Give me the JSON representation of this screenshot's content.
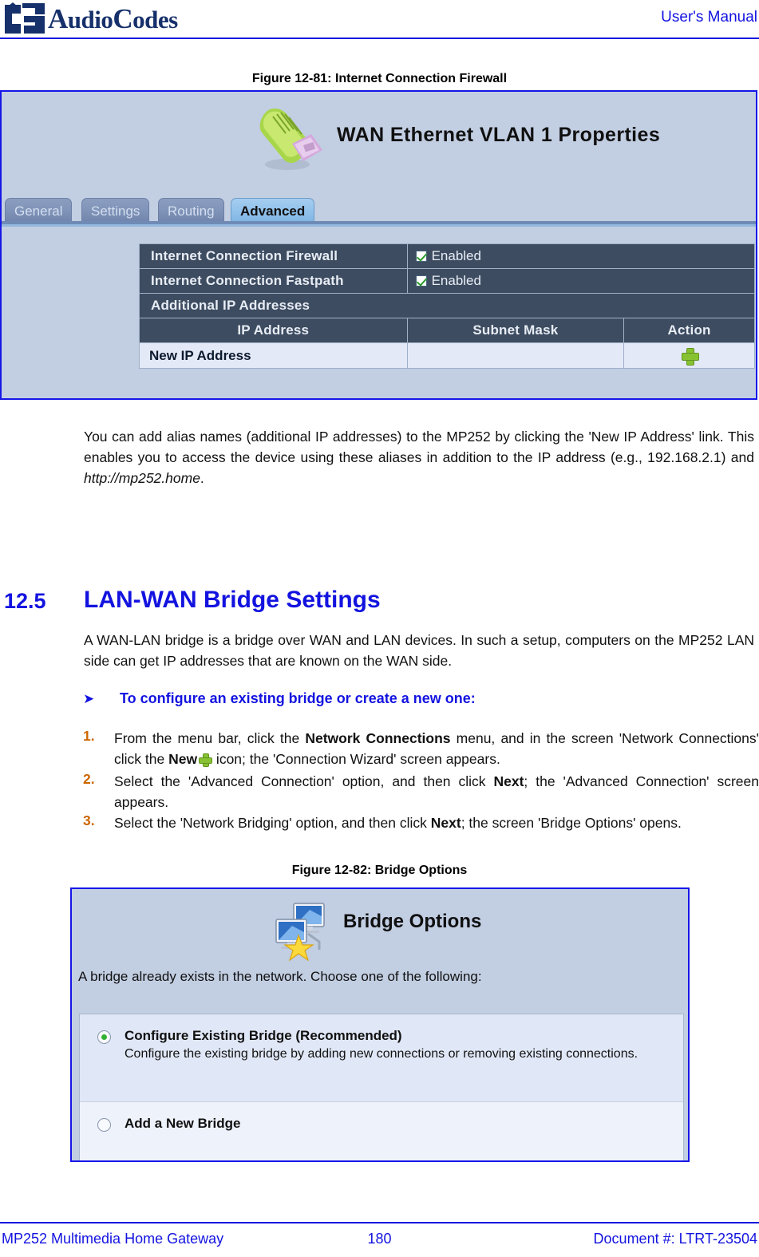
{
  "header": {
    "brand": "AudioCodes",
    "brand_prefix": "Audio",
    "brand_suffix": "Codes",
    "manual_label": "User's Manual",
    "logo_icon": "audiocodes-logo-icon",
    "brand_color": "#16306b",
    "accent_color": "#1313e0"
  },
  "figure1": {
    "caption": "Figure 12-81: Internet Connection Firewall",
    "title": "WAN Ethernet VLAN 1 Properties",
    "title_icon": "ethernet-plug-icon",
    "tabs": [
      {
        "label": "General",
        "active": false
      },
      {
        "label": "Settings",
        "active": false
      },
      {
        "label": "Routing",
        "active": false
      },
      {
        "label": "Advanced",
        "active": true
      }
    ],
    "settings": [
      {
        "label": "Internet Connection Firewall",
        "value": "Enabled",
        "checked": true
      },
      {
        "label": "Internet Connection Fastpath",
        "value": "Enabled",
        "checked": true
      }
    ],
    "section_label": "Additional IP Addresses",
    "table_headers": [
      "IP Address",
      "Subnet Mask",
      "Action"
    ],
    "table_rows": [
      {
        "ip_address": "New IP Address",
        "subnet_mask": "",
        "action_icon": "add-plus-icon"
      }
    ],
    "colors": {
      "panel_bg": "#c2cee2",
      "row_dark": "#3d4c60",
      "row_light": "#e3e9f7",
      "border": "#1616e8"
    }
  },
  "body_paragraph_1": "You can add alias names (additional IP addresses) to the MP252 by clicking the 'New IP Address' link. This enables you to access the device using these aliases in addition to the IP address (e.g., 192.168.2.1) and ",
  "body_paragraph_1_italic": "http://mp252.home",
  "body_paragraph_1_end": ".",
  "section": {
    "number": "12.5",
    "title": "LAN-WAN Bridge Settings",
    "intro": "A WAN-LAN bridge is a bridge over WAN and LAN devices. In such a setup, computers on the MP252 LAN side can get IP addresses that are known on the WAN side."
  },
  "procedure": {
    "heading": "To configure an existing bridge or create a new one:",
    "arrow_icon": "triangle-right-icon",
    "steps": [
      {
        "num": "1.",
        "part1": "From the menu bar, click the ",
        "bold1": "Network Connections",
        "part2": " menu, and in the screen 'Network Connections' click the ",
        "bold2": "New",
        "icon": "add-plus-icon",
        "part3": " icon; the 'Connection Wizard' screen appears."
      },
      {
        "num": "2.",
        "part1": "Select the 'Advanced Connection' option, and then click ",
        "bold1": "Next",
        "part2": "; the 'Advanced Connection' screen appears."
      },
      {
        "num": "3.",
        "part1": "Select the 'Network Bridging' option, and then click ",
        "bold1": "Next",
        "part2": "; the screen 'Bridge Options' opens."
      }
    ]
  },
  "figure2": {
    "caption": "Figure 12-82: Bridge Options",
    "title": "Bridge Options",
    "title_icon": "network-bridge-wizard-icon",
    "prompt": "A bridge already exists in the network. Choose one of the following:",
    "options": [
      {
        "label": "Configure Existing Bridge (Recommended)",
        "description": "Configure the existing bridge by adding new connections or removing existing connections.",
        "selected": true
      },
      {
        "label": "Add a New Bridge",
        "description": "",
        "selected": false
      }
    ]
  },
  "footer": {
    "left": "MP252 Multimedia Home Gateway",
    "page_number": "180",
    "right": "Document #: LTRT-23504"
  }
}
